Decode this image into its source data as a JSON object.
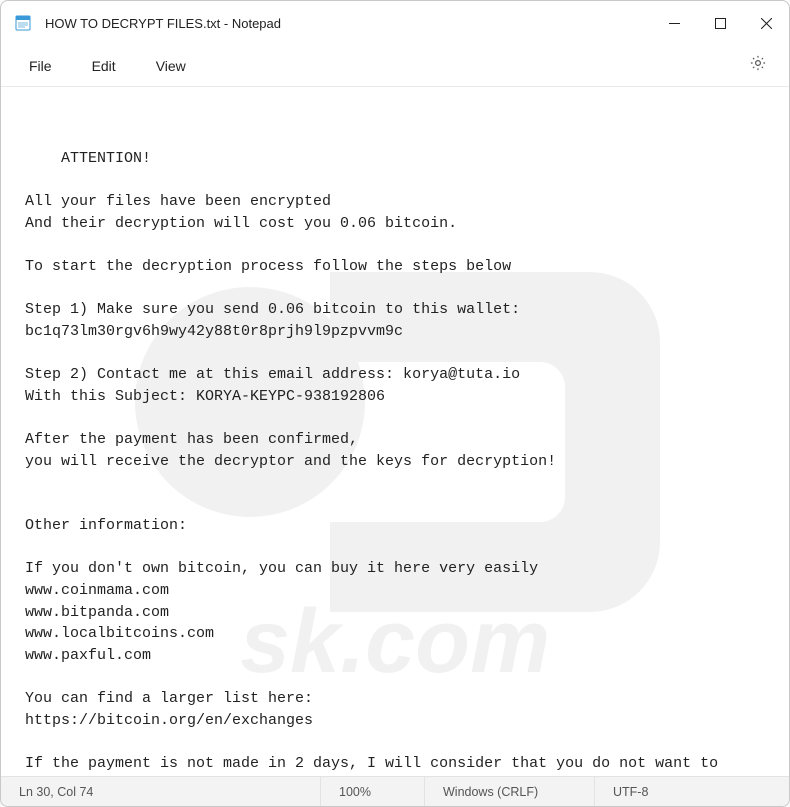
{
  "titlebar": {
    "title": "HOW TO DECRYPT FILES.txt - Notepad"
  },
  "menubar": {
    "file": "File",
    "edit": "Edit",
    "view": "View"
  },
  "editor": {
    "content": "ATTENTION!\n\nAll your files have been encrypted\nAnd their decryption will cost you 0.06 bitcoin.\n\nTo start the decryption process follow the steps below\n\nStep 1) Make sure you send 0.06 bitcoin to this wallet:\nbc1q73lm30rgv6h9wy42y88t0r8prjh9l9pzpvvm9c\n\nStep 2) Contact me at this email address: korya@tuta.io\nWith this Subject: KORYA-KEYPC-938192806\n\nAfter the payment has been confirmed,\nyou will receive the decryptor and the keys for decryption!\n\n\nOther information:\n\nIf you don't own bitcoin, you can buy it here very easily\nwww.coinmama.com\nwww.bitpanda.com\nwww.localbitcoins.com\nwww.paxful.com\n\nYou can find a larger list here:\nhttps://bitcoin.org/en/exchanges\n\nIf the payment is not made in 2 days, I will consider that you do not want to decrypt your files,\nand therefore the keys generated for your PC will be permanently.deleted."
  },
  "statusbar": {
    "position": "Ln 30, Col 74",
    "zoom": "100%",
    "eol": "Windows (CRLF)",
    "encoding": "UTF-8"
  }
}
